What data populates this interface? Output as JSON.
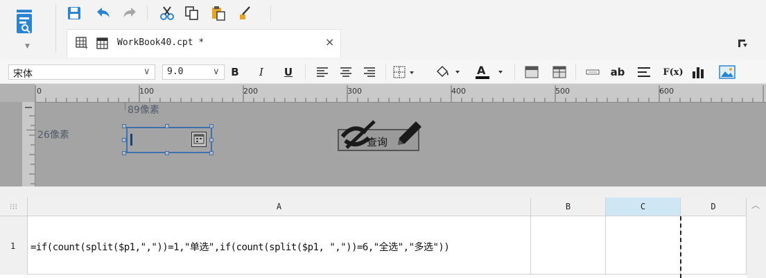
{
  "toolbar": {
    "icons": [
      "save-icon",
      "undo-icon",
      "redo-icon",
      "cut-icon",
      "copy-icon",
      "paste-icon",
      "format-painter-icon"
    ]
  },
  "tab": {
    "title": "WorkBook40.cpt *",
    "close": "×"
  },
  "format_bar": {
    "font_name": "宋体",
    "font_size": "9.0",
    "bold": "B",
    "italic": "I",
    "underline": "U",
    "text_button": "ab",
    "formula_button": "F(x)"
  },
  "ruler": {
    "ticks": [
      "0",
      "100",
      "200",
      "300",
      "400",
      "500",
      "600"
    ]
  },
  "canvas": {
    "width_label": "89像素",
    "height_label": "26像素",
    "query_button_label": "查询"
  },
  "sheet": {
    "columns": [
      "A",
      "B",
      "C",
      "D"
    ],
    "rows": [
      {
        "number": "1",
        "a": "=if(count(split($p1,\",\"))=1,\"单选\",if(count(split($p1,  \",\"))=6,\"全选\",\"多选\"))"
      }
    ],
    "selected_column": "C",
    "accent": "#cfe7f5"
  }
}
